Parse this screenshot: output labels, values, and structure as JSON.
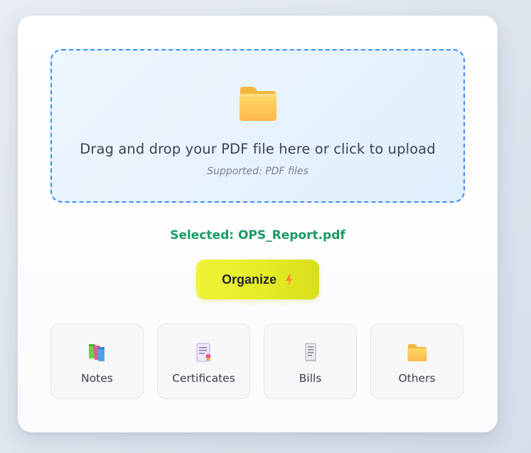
{
  "upload": {
    "title": "Drag and drop your PDF file here or click to upload",
    "subtitle": "Supported: PDF files",
    "icon": "folder-icon"
  },
  "selected_text": "Selected: OPS_Report.pdf",
  "organize_button": {
    "label": "Organize",
    "icon": "lightning-icon"
  },
  "categories": [
    {
      "label": "Notes",
      "icon": "books-icon"
    },
    {
      "label": "Certificates",
      "icon": "certificate-icon"
    },
    {
      "label": "Bills",
      "icon": "receipt-icon"
    },
    {
      "label": "Others",
      "icon": "folder-icon"
    }
  ],
  "colors": {
    "accent_border": "#3d8ef0",
    "selected_text": "#1a9a62",
    "button_fill": "#e8ef2c"
  }
}
